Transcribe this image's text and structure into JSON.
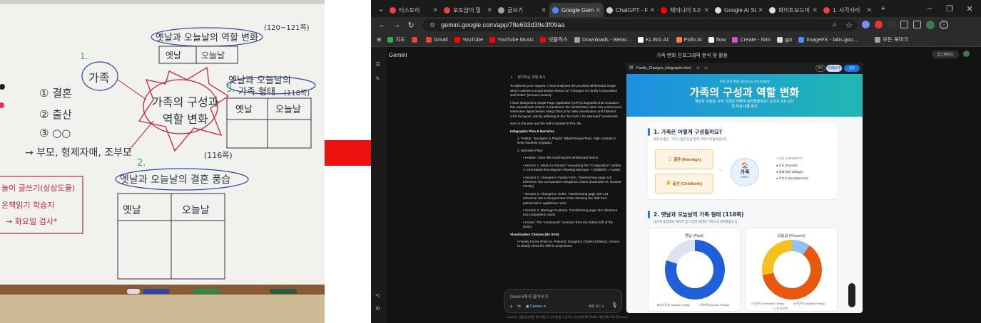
{
  "whiteboard": {
    "center_title": "가족의 구성과\n역할 변화",
    "family_label": "가족",
    "num1": "1.",
    "num2": "2.",
    "num3": "3.",
    "item1": "① 결혼",
    "item2": "② 출산",
    "item3": "③ ○○",
    "arrow_line": "→ 부모, 형제자매, 조부모",
    "roles_title": "옛날과 오늘날의 역할 변화",
    "roles_pages": "(120~121쪽)",
    "col_past": "옛날",
    "col_now": "오늘날",
    "forms_title": "옛날과 오늘날의",
    "forms_title2": "가족 형태",
    "forms_pages": "(118쪽)",
    "customs_title": "옛날과 오늘날의 결혼 풍습",
    "customs_pages": "(116쪽)",
    "homework1": "놀이 글쓰기(상상도울)",
    "homework2": "온책읽기 학습지",
    "homework3": "→ 화요일 검사*"
  },
  "browser": {
    "tabs": [
      {
        "label": "티스토리",
        "color": "#e8453c"
      },
      {
        "label": "포토샵이 밀",
        "color": "#e8453c"
      },
      {
        "label": "글쓰기",
        "color": "#9aa0a6"
      },
      {
        "label": "Google Gem",
        "color": "#4c8df6",
        "active": true
      },
      {
        "label": "ChatGPT - F",
        "color": "#cccccc"
      },
      {
        "label": "제미나이 3.0",
        "color": "#ff0000"
      },
      {
        "label": "Google AI St",
        "color": "#dddddd"
      },
      {
        "label": "화이트보드미",
        "color": "#dddddd"
      },
      {
        "label": "1. 사각사리",
        "color": "#e8453c"
      }
    ],
    "url": "gemini.google.com/app/78e693d39e3f09aa",
    "bookmarks": [
      {
        "label": "지도",
        "color": "#34a853"
      },
      {
        "label": "",
        "color": "#e8453c"
      },
      {
        "label": "Gmail",
        "color": "#e8453c"
      },
      {
        "label": "YouTube",
        "color": "#ff0000"
      },
      {
        "label": "YouTube Music",
        "color": "#ff0000"
      },
      {
        "label": "넷플릭스",
        "color": "#e50914"
      },
      {
        "label": "Downloads - Betac...",
        "color": "#9aa0a6"
      },
      {
        "label": "KLING AI:",
        "color": "#ffffff"
      },
      {
        "label": "Pollo AI",
        "color": "#ff7a45"
      },
      {
        "label": "flow",
        "color": "#ffffff"
      },
      {
        "label": "Create - Nim",
        "color": "#d94fcf"
      },
      {
        "label": "gpt",
        "color": "#dddddd"
      },
      {
        "label": "ImageFX - labs.goo...",
        "color": "#4c8df6"
      },
      {
        "label": "모든 북마크",
        "color": "#9aa0a6"
      }
    ]
  },
  "gemini": {
    "app_name": "Gemini",
    "conversation_title": "가족 변화 인포그래픽 분석 및 활용",
    "upgrade": "업그레이드",
    "thinking": "생각하는 과정 표시",
    "p1": "To address your request, I have analyzed the provided whiteboard image which outlines a social studies lesson on \"Changes in Family Composition and Roles\" (Korean context).",
    "p2": "I have designed a Single Page Application (SPA) infographic that visualizes this educational content. It transforms the handwritten notes into a structured, interactive digital lesson using Chart.js for data visualization and Tailwind CSS for layout, strictly adhering to the \"No SVG / No Mermaid\" constraints.",
    "p3": "Here is the plan and the self-contained HTML file.",
    "h1": "Infographic Plan & Narrative",
    "l1": "1. Palette: \"Energetic & Playful\" (Blue/Orange/Teal). High contrast to keep students engaged.",
    "l2": "2. Narrative Flow:",
    "s1": "• Header: Clear title matching the whiteboard theme.",
    "s2": "• Section 1: What is a Family? Visualizing the \"Composition\" bubble. A CSS-based flow diagram showing Marriage + Childbirth = Family.",
    "s3": "• Section 2: Changes in Family Form. Transforming page 118 reference into Comparative Doughnut Charts (Extended vs. Nuclear Family).",
    "s4": "• Section 3: Changes in Roles. Transforming page 120-121 reference into a Grouped Bar Chart showing the shift from patriarchal to egalitarian roles.",
    "s5": "• Section 4: Marriage Customs. Transforming page 116 reference into comparison cards.",
    "s6": "• Footer: The \"Homework\" reminder from the bottom left of the board.",
    "h2": "Visualization Choices (No SVG)",
    "s7": "• Family Forms (Past vs. Present): Doughnut Charts (Chart.js), chosen to clearly show the shift in proportions",
    "input_placeholder": "Gemini에게 물어보기",
    "canvas_label": "Canvas",
    "mode": "빠른 모드",
    "footer": "Gemini는 인물 등에 관한 정보 제공 시 실수를 할 수 있으니 다시 한번 확인하세요. 개인 정보 보호 및 Gemini"
  },
  "canvas": {
    "filename": "Family_Changes_Infographic.html",
    "code_label": "코드",
    "preview_label": "미리보기",
    "share_label": "공유",
    "kicker": "사회 교과 학습 (SOCIAL STUDIES)",
    "title": "가족의 구성과 역할 변화",
    "subtitle": "옛날과 오늘날, 우리 가족은 어떻게 달라졌을까요? 교과서 116~121쪽 핵심 내용 정리",
    "sec1_title": "1. 가족은 어떻게 구성될까요?",
    "sec1_sub": "결혼과 출산, 그리고 입양 등을 통해 가족이 만들어집니다.",
    "marriage": "결혼 (Marriage)",
    "birth": "출산 (Childbirth)",
    "family": "가족",
    "family_en": "FAMILY",
    "members_title": "구성원 (MEMBERS)",
    "members": [
      "부모 (Parents)",
      "형제자매 (Siblings)",
      "조부모 (Grandparents)"
    ],
    "sec2_title": "2. 옛날과 오늘날의 가족 형태 (118쪽)",
    "sec2_sub": "대가족 중심에서 핵가족 및 다양한 형태의 가족으로 변화했습니다.",
    "past_label": "옛날 (Past)",
    "present_label": "오늘날 (Present)",
    "legend_past": [
      "대가족 (Extended Family)",
      "핵가족 (Nuclear Family)"
    ],
    "legend_present": [
      "대가족 (Extended Family)",
      "핵가족 (Nuclear Family)",
      "1인 가구 등"
    ]
  },
  "chart_data": [
    {
      "type": "pie",
      "title": "옛날 (Past)",
      "categories": [
        "대가족 (Extended Family)",
        "핵가족 (Nuclear Family)"
      ],
      "values": [
        80,
        20
      ],
      "colors": [
        "#1f5fd8",
        "#dde3ee"
      ]
    },
    {
      "type": "pie",
      "title": "오늘날 (Present)",
      "categories": [
        "대가족 (Extended Family)",
        "핵가족 (Nuclear Family)",
        "1인 가구 등"
      ],
      "values": [
        10,
        62,
        28
      ],
      "colors": [
        "#8fc1f3",
        "#e8580f",
        "#f3c21c"
      ]
    }
  ]
}
